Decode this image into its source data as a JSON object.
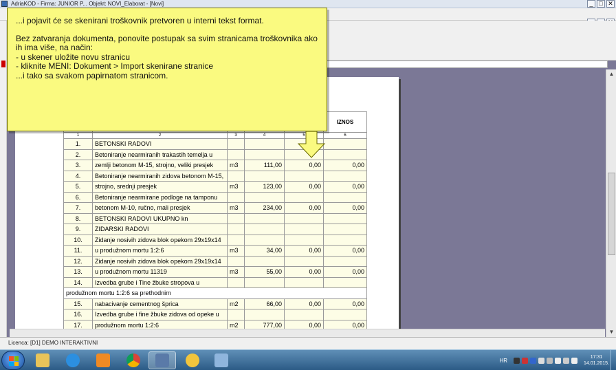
{
  "window": {
    "title": "AdriaKOD - Firma: JUNIOR P...     Objekt: NOVI_Elaborat - [Novi]"
  },
  "callout": {
    "line1": "...i pojavit će se skenirani troškovnik pretvoren u interni tekst format.",
    "line2": "Bez zatvaranja dokumenta, ponovite postupak sa svim stranicama troškovnika ako ih ima više, na način:",
    "line3": "- u skener uložite novu stranicu",
    "line4": "- kliknite MENI: Dokument > Import skenirane stranice",
    "line5": "...i tako sa svakom papirnatom stranicom."
  },
  "table": {
    "header_amount": "IZNOS",
    "col_numbers": [
      "1",
      "2",
      "3",
      "4",
      "5",
      "6"
    ],
    "rows": [
      {
        "no": "1.",
        "desc": "BETONSKI RADOVI",
        "unit": "",
        "qty": "",
        "price": "",
        "amount": ""
      },
      {
        "no": "2.",
        "desc": "Betoniranje nearmiranih trakastih temelja u",
        "unit": "",
        "qty": "",
        "price": "",
        "amount": ""
      },
      {
        "no": "3.",
        "desc": "zemlji betonom M-15, strojno, veliki presjek",
        "unit": "m3",
        "qty": "111,00",
        "price": "0,00",
        "amount": "0,00"
      },
      {
        "no": "4.",
        "desc": "Betoniranje nearmiranih zidova betonom M-15,",
        "unit": "",
        "qty": "",
        "price": "",
        "amount": ""
      },
      {
        "no": "5.",
        "desc": "strojno, srednji presjek",
        "unit": "m3",
        "qty": "123,00",
        "price": "0,00",
        "amount": "0,00"
      },
      {
        "no": "6.",
        "desc": "Betoniranje nearmirane podloge na tamponu",
        "unit": "",
        "qty": "",
        "price": "",
        "amount": ""
      },
      {
        "no": "7.",
        "desc": "betonom M-10, ručno, mali presjek",
        "unit": "m3",
        "qty": "234,00",
        "price": "0,00",
        "amount": "0,00"
      },
      {
        "no": "8.",
        "desc": "BETONSKI RADOVI UKUPNO kn",
        "unit": "",
        "qty": "",
        "price": "",
        "amount": ""
      },
      {
        "no": "9.",
        "desc": "ZIDARSKI RADOVI",
        "unit": "",
        "qty": "",
        "price": "",
        "amount": ""
      },
      {
        "no": "10.",
        "desc": "Zidanje nosivih zidova blok opekom 29x19x14",
        "unit": "",
        "qty": "",
        "price": "",
        "amount": ""
      },
      {
        "no": "11.",
        "desc": "u produžnom mortu 1:2:6",
        "unit": "m3",
        "qty": "34,00",
        "price": "0,00",
        "amount": "0,00"
      },
      {
        "no": "12.",
        "desc": "Zidanje nosivih zidova blok opekom 29x19x14",
        "unit": "",
        "qty": "",
        "price": "",
        "amount": ""
      },
      {
        "no": "13.",
        "desc": "u produžnom mortu 11319",
        "unit": "m3",
        "qty": "55,00",
        "price": "0,00",
        "amount": "0,00"
      },
      {
        "no": "14.",
        "desc": "Izvedba grube i  Tine žbuke stropova u",
        "unit": "",
        "qty": "",
        "price": "",
        "amount": ""
      },
      {
        "span": "produžnom mortu 1:2:6 sa prethodnim"
      },
      {
        "no": "15.",
        "desc": "nabacivanje cementnog šprica",
        "unit": "m2",
        "qty": "66,00",
        "price": "0,00",
        "amount": "0,00"
      },
      {
        "no": "16.",
        "desc": "Izvedba grube i  fine žbuke zidova od opeke u",
        "unit": "",
        "qty": "",
        "price": "",
        "amount": ""
      },
      {
        "no": "17.",
        "desc": "produžnom mortu 1:2:6",
        "unit": "m2",
        "qty": "777,00",
        "price": "0,00",
        "amount": "0,00"
      }
    ]
  },
  "status": {
    "license": "Licenca:  [D1] DEMO INTERAKTIVNI"
  },
  "taskbar": {
    "lang": "HR",
    "time": "17:31",
    "date": "14.01.2015."
  }
}
